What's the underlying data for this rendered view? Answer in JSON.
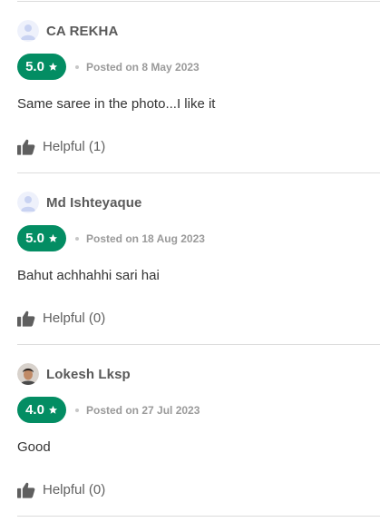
{
  "colors": {
    "rating_badge": "#038d63",
    "divider": "#dcdcdc",
    "reviewer_name": "#5a5a5a",
    "posted_text": "#9a9a9a"
  },
  "icons": {
    "star": "star-icon",
    "thumb": "thumbs-up-icon",
    "avatar": "user-avatar-icon"
  },
  "reviews": [
    {
      "reviewer": "CA REKHA",
      "avatar_type": "placeholder",
      "rating": "5.0",
      "posted": "Posted on 8 May 2023",
      "text": "Same saree in the photo...I like it",
      "helpful": "Helpful (1)"
    },
    {
      "reviewer": "Md Ishteyaque",
      "avatar_type": "placeholder",
      "rating": "5.0",
      "posted": "Posted on 18 Aug 2023",
      "text": "Bahut achhahhi sari hai",
      "helpful": "Helpful (0)"
    },
    {
      "reviewer": "Lokesh Lksp",
      "avatar_type": "photo",
      "rating": "4.0",
      "posted": "Posted on 27 Jul 2023",
      "text": "Good",
      "helpful": "Helpful (0)"
    }
  ]
}
